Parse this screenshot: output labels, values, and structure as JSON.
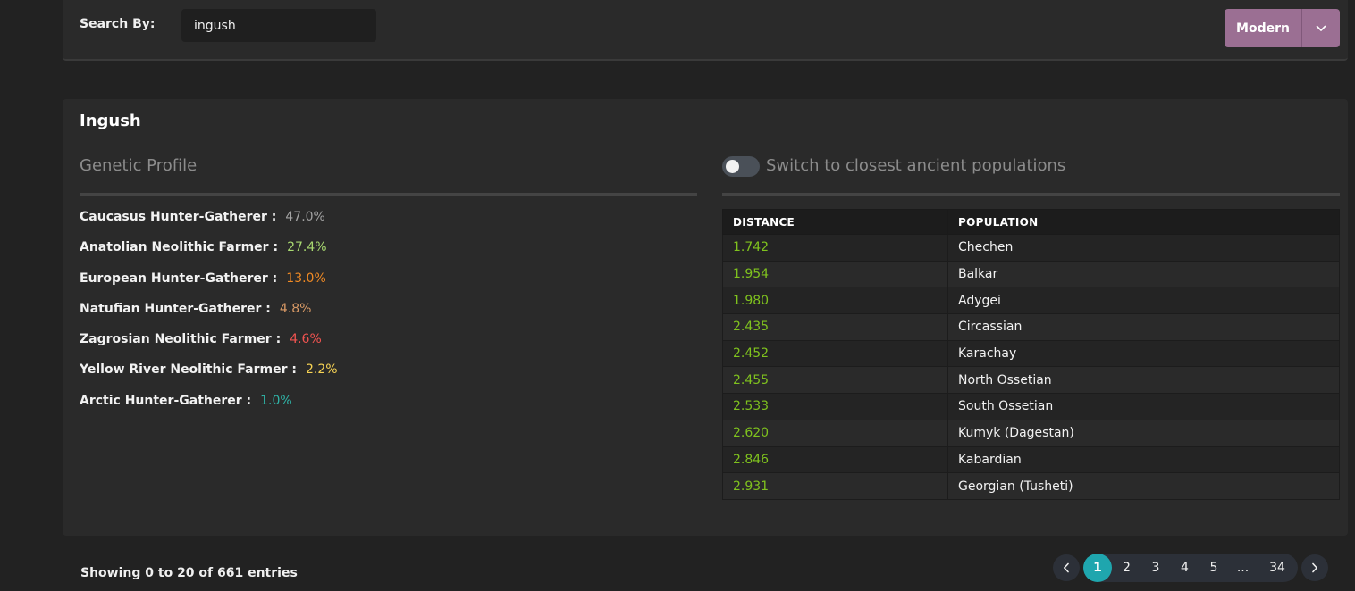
{
  "search": {
    "label": "Search By:",
    "value": "ingush",
    "mode_label": "Modern"
  },
  "profile": {
    "population": "Ingush",
    "heading": "Genetic Profile",
    "components": [
      {
        "name": "Caucasus Hunter-Gatherer :",
        "value": "47.0%",
        "color": "#a3a3a3"
      },
      {
        "name": "Anatolian Neolithic Farmer :",
        "value": "27.4%",
        "color": "#a8d870"
      },
      {
        "name": "European Hunter-Gatherer :",
        "value": "13.0%",
        "color": "#f08a24"
      },
      {
        "name": "Natufian Hunter-Gatherer :",
        "value": "4.8%",
        "color": "#d99a66"
      },
      {
        "name": "Zagrosian Neolithic Farmer :",
        "value": "4.6%",
        "color": "#ef5350"
      },
      {
        "name": "Yellow River Neolithic Farmer :",
        "value": "2.2%",
        "color": "#f7d354"
      },
      {
        "name": "Arctic Hunter-Gatherer :",
        "value": "1.0%",
        "color": "#2fb5a8"
      }
    ]
  },
  "ancient_toggle": {
    "label": "Switch to closest ancient populations",
    "enabled": false
  },
  "distance_table": {
    "columns": [
      "DISTANCE",
      "POPULATION"
    ],
    "rows": [
      {
        "distance": "1.742",
        "population": "Chechen"
      },
      {
        "distance": "1.954",
        "population": "Balkar"
      },
      {
        "distance": "1.980",
        "population": "Adygei"
      },
      {
        "distance": "2.435",
        "population": "Circassian"
      },
      {
        "distance": "2.452",
        "population": "Karachay"
      },
      {
        "distance": "2.455",
        "population": "North Ossetian"
      },
      {
        "distance": "2.533",
        "population": "South Ossetian"
      },
      {
        "distance": "2.620",
        "population": "Kumyk (Dagestan)"
      },
      {
        "distance": "2.846",
        "population": "Kabardian"
      },
      {
        "distance": "2.931",
        "population": "Georgian (Tusheti)"
      }
    ]
  },
  "pagination": {
    "info": "Showing 0 to 20 of 661 entries",
    "pages": [
      "1",
      "2",
      "3",
      "4",
      "5",
      "...",
      "34"
    ],
    "current": "1"
  },
  "colors": {
    "accent": "#1fa6ae",
    "mode_button": "#9b6f93",
    "distance_text": "#7fc21e"
  },
  "icons": {
    "mode_caret": "chevron-down-icon",
    "prev": "chevron-left-icon",
    "next": "chevron-right-icon"
  }
}
